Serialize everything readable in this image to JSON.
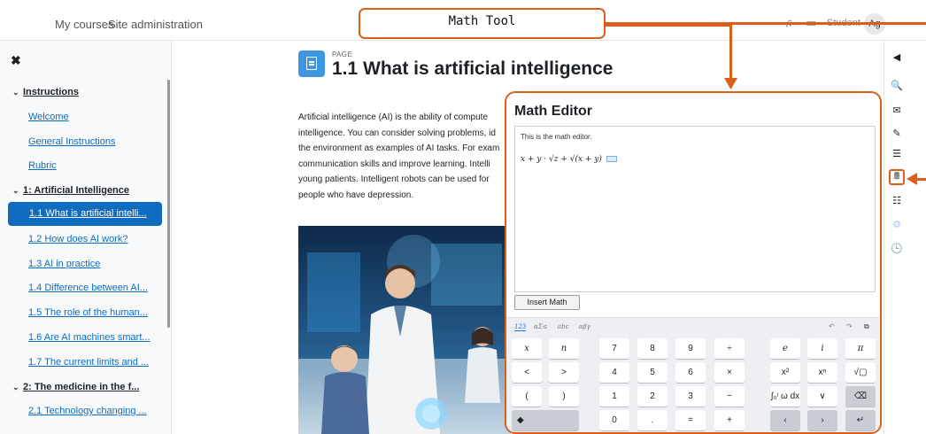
{
  "nav": {
    "my_courses": "My courses",
    "site_admin": "Site administration",
    "user": "Student",
    "avatar": "Ag"
  },
  "callout": {
    "label": "Math Tool",
    "color": "#d95f1a"
  },
  "drawer": {
    "close": "✖",
    "items": [
      {
        "label": "Instructions",
        "type": "section"
      },
      {
        "label": "Welcome",
        "type": "link"
      },
      {
        "label": "General Instructions",
        "type": "link"
      },
      {
        "label": "Rubric",
        "type": "link"
      },
      {
        "label": "1: Artificial Intelligence",
        "type": "section"
      },
      {
        "label": "1.1 What is artificial intelli...",
        "type": "active"
      },
      {
        "label": "1.2 How does AI work?",
        "type": "link"
      },
      {
        "label": "1.3 AI in practice",
        "type": "link"
      },
      {
        "label": "1.4 Difference between AI...",
        "type": "link"
      },
      {
        "label": "1.5 The role of the human...",
        "type": "link"
      },
      {
        "label": "1.6 Are AI machines smart...",
        "type": "link"
      },
      {
        "label": "1.7 The current limits and ...",
        "type": "link"
      },
      {
        "label": "2: The medicine in the f...",
        "type": "section"
      },
      {
        "label": "2.1 Technology changing ...",
        "type": "link"
      }
    ]
  },
  "page": {
    "label": "PAGE",
    "title": "1.1 What is artificial intelligence",
    "body_lines": [
      "Artificial intelligence (AI) is the ability of compute",
      "intelligence. You can consider solving problems, id",
      "the environment as examples of AI tasks. For exam",
      "communication skills and improve learning. Intelli",
      "young patients. Intelligent robots can be used for",
      "people who have depression."
    ]
  },
  "math_editor": {
    "title": "Math Editor",
    "description": "This is the math editor.",
    "formula": "x + y · √z + √(x + y)",
    "insert_button": "Insert Math",
    "tabs": [
      "123",
      "αΣ≤",
      "abc",
      "αβγ"
    ],
    "tools": [
      "↶",
      "↷",
      "⧉"
    ],
    "keys": [
      [
        "x",
        "n",
        "7",
        "8",
        "9",
        "÷",
        "e",
        "i",
        "π"
      ],
      [
        "<",
        ">",
        "4",
        "5",
        "6",
        "×",
        "x²",
        "xⁿ",
        "√▢"
      ],
      [
        "(",
        ")",
        "1",
        "2",
        "3",
        "−",
        "∫₀ᶦ ω dx",
        "∨",
        "⌫"
      ],
      [
        "◆",
        "0",
        ".",
        "=",
        "+",
        "‹",
        "›",
        "↵"
      ]
    ]
  },
  "right_blocks": [
    "◀",
    "🔍",
    "✉",
    "✎",
    "☰",
    "🖩",
    "☷",
    "⚙",
    "🕒"
  ]
}
